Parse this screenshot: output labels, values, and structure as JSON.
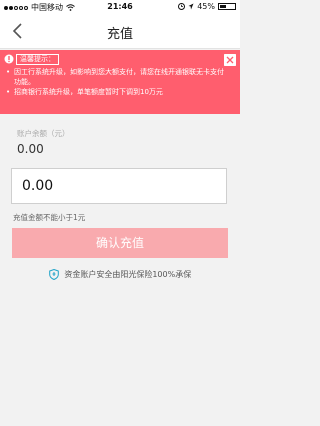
{
  "status_bar": {
    "carrier": "中国移动",
    "time": "21:46",
    "battery": "45%",
    "battery_level": 0.45
  },
  "nav": {
    "title": "充值",
    "back_icon": "chevron-left-icon"
  },
  "notice": {
    "title": "温馨提示：",
    "items": [
      "因工行系统升级，如影响到您大额支付，请您在线开通银联无卡支付功能。",
      "招商银行系统升级，单笔额度暂时下调到10万元"
    ],
    "close_icon": "close-icon",
    "warn_icon": "warning-icon",
    "background_color": "#ff5e6e"
  },
  "balance": {
    "label": "账户余额（元）",
    "value": "0.00"
  },
  "amount_input": {
    "value": "0.00"
  },
  "min_hint": "充值金额不能小于1元",
  "confirm_button": {
    "label": "确认充值",
    "color": "#f9aaae"
  },
  "security": {
    "icon": "shield-icon",
    "text": "资金账户安全由阳光保险100%承保"
  }
}
